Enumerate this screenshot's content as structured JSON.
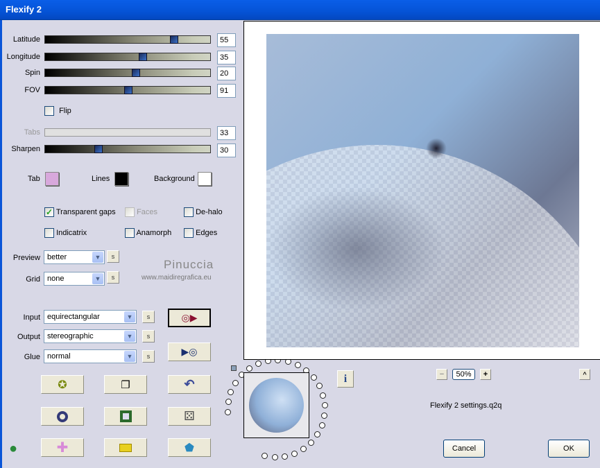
{
  "window": {
    "title": "Flexify 2"
  },
  "sliders": [
    {
      "label": "Latitude",
      "value": "55",
      "thumb_pos": 0.79
    },
    {
      "label": "Longitude",
      "value": "35",
      "thumb_pos": 0.59
    },
    {
      "label": "Spin",
      "value": "20",
      "thumb_pos": 0.55
    },
    {
      "label": "FOV",
      "value": "91",
      "thumb_pos": 0.5
    }
  ],
  "flip": {
    "label": "Flip",
    "checked": false
  },
  "tabs": {
    "label": "Tabs",
    "value": "33"
  },
  "sharpen": {
    "label": "Sharpen",
    "value": "30",
    "thumb_pos": 0.31
  },
  "colors": {
    "tab_label": "Tab",
    "tab_color": "#d8a8dc",
    "lines_label": "Lines",
    "lines_color": "#000000",
    "background_label": "Background",
    "background_color": "#ffffff"
  },
  "options": {
    "transparent_gaps": "Transparent gaps",
    "faces": "Faces",
    "dehalo": "De-halo",
    "indicatrix": "Indicatrix",
    "anamorph": "Anamorph",
    "edges": "Edges"
  },
  "preview_mode": {
    "label": "Preview",
    "value": "better"
  },
  "grid": {
    "label": "Grid",
    "value": "none"
  },
  "watermark": {
    "name": "Pinuccia",
    "url": "www.maidiregrafica.eu"
  },
  "input": {
    "label": "Input",
    "value": "equirectangular"
  },
  "output": {
    "label": "Output",
    "value": "stereographic"
  },
  "glue": {
    "label": "Glue",
    "value": "normal"
  },
  "s_label": "s",
  "zoom": {
    "value": "50%",
    "minus": "−",
    "plus": "+",
    "collapse": "^"
  },
  "settings_file": "Flexify 2 settings.q2q",
  "info_label": "i",
  "buttons": {
    "cancel": "Cancel",
    "ok": "OK"
  }
}
